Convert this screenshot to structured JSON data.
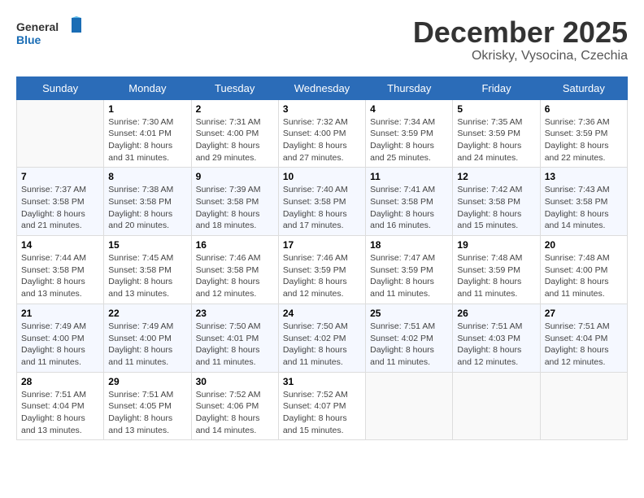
{
  "header": {
    "logo_general": "General",
    "logo_blue": "Blue",
    "month_title": "December 2025",
    "subtitle": "Okrisky, Vysocina, Czechia"
  },
  "days_of_week": [
    "Sunday",
    "Monday",
    "Tuesday",
    "Wednesday",
    "Thursday",
    "Friday",
    "Saturday"
  ],
  "weeks": [
    [
      {
        "day": "",
        "info": ""
      },
      {
        "day": "1",
        "info": "Sunrise: 7:30 AM\nSunset: 4:01 PM\nDaylight: 8 hours\nand 31 minutes."
      },
      {
        "day": "2",
        "info": "Sunrise: 7:31 AM\nSunset: 4:00 PM\nDaylight: 8 hours\nand 29 minutes."
      },
      {
        "day": "3",
        "info": "Sunrise: 7:32 AM\nSunset: 4:00 PM\nDaylight: 8 hours\nand 27 minutes."
      },
      {
        "day": "4",
        "info": "Sunrise: 7:34 AM\nSunset: 3:59 PM\nDaylight: 8 hours\nand 25 minutes."
      },
      {
        "day": "5",
        "info": "Sunrise: 7:35 AM\nSunset: 3:59 PM\nDaylight: 8 hours\nand 24 minutes."
      },
      {
        "day": "6",
        "info": "Sunrise: 7:36 AM\nSunset: 3:59 PM\nDaylight: 8 hours\nand 22 minutes."
      }
    ],
    [
      {
        "day": "7",
        "info": "Sunrise: 7:37 AM\nSunset: 3:58 PM\nDaylight: 8 hours\nand 21 minutes."
      },
      {
        "day": "8",
        "info": "Sunrise: 7:38 AM\nSunset: 3:58 PM\nDaylight: 8 hours\nand 20 minutes."
      },
      {
        "day": "9",
        "info": "Sunrise: 7:39 AM\nSunset: 3:58 PM\nDaylight: 8 hours\nand 18 minutes."
      },
      {
        "day": "10",
        "info": "Sunrise: 7:40 AM\nSunset: 3:58 PM\nDaylight: 8 hours\nand 17 minutes."
      },
      {
        "day": "11",
        "info": "Sunrise: 7:41 AM\nSunset: 3:58 PM\nDaylight: 8 hours\nand 16 minutes."
      },
      {
        "day": "12",
        "info": "Sunrise: 7:42 AM\nSunset: 3:58 PM\nDaylight: 8 hours\nand 15 minutes."
      },
      {
        "day": "13",
        "info": "Sunrise: 7:43 AM\nSunset: 3:58 PM\nDaylight: 8 hours\nand 14 minutes."
      }
    ],
    [
      {
        "day": "14",
        "info": "Sunrise: 7:44 AM\nSunset: 3:58 PM\nDaylight: 8 hours\nand 13 minutes."
      },
      {
        "day": "15",
        "info": "Sunrise: 7:45 AM\nSunset: 3:58 PM\nDaylight: 8 hours\nand 13 minutes."
      },
      {
        "day": "16",
        "info": "Sunrise: 7:46 AM\nSunset: 3:58 PM\nDaylight: 8 hours\nand 12 minutes."
      },
      {
        "day": "17",
        "info": "Sunrise: 7:46 AM\nSunset: 3:59 PM\nDaylight: 8 hours\nand 12 minutes."
      },
      {
        "day": "18",
        "info": "Sunrise: 7:47 AM\nSunset: 3:59 PM\nDaylight: 8 hours\nand 11 minutes."
      },
      {
        "day": "19",
        "info": "Sunrise: 7:48 AM\nSunset: 3:59 PM\nDaylight: 8 hours\nand 11 minutes."
      },
      {
        "day": "20",
        "info": "Sunrise: 7:48 AM\nSunset: 4:00 PM\nDaylight: 8 hours\nand 11 minutes."
      }
    ],
    [
      {
        "day": "21",
        "info": "Sunrise: 7:49 AM\nSunset: 4:00 PM\nDaylight: 8 hours\nand 11 minutes."
      },
      {
        "day": "22",
        "info": "Sunrise: 7:49 AM\nSunset: 4:00 PM\nDaylight: 8 hours\nand 11 minutes."
      },
      {
        "day": "23",
        "info": "Sunrise: 7:50 AM\nSunset: 4:01 PM\nDaylight: 8 hours\nand 11 minutes."
      },
      {
        "day": "24",
        "info": "Sunrise: 7:50 AM\nSunset: 4:02 PM\nDaylight: 8 hours\nand 11 minutes."
      },
      {
        "day": "25",
        "info": "Sunrise: 7:51 AM\nSunset: 4:02 PM\nDaylight: 8 hours\nand 11 minutes."
      },
      {
        "day": "26",
        "info": "Sunrise: 7:51 AM\nSunset: 4:03 PM\nDaylight: 8 hours\nand 12 minutes."
      },
      {
        "day": "27",
        "info": "Sunrise: 7:51 AM\nSunset: 4:04 PM\nDaylight: 8 hours\nand 12 minutes."
      }
    ],
    [
      {
        "day": "28",
        "info": "Sunrise: 7:51 AM\nSunset: 4:04 PM\nDaylight: 8 hours\nand 13 minutes."
      },
      {
        "day": "29",
        "info": "Sunrise: 7:51 AM\nSunset: 4:05 PM\nDaylight: 8 hours\nand 13 minutes."
      },
      {
        "day": "30",
        "info": "Sunrise: 7:52 AM\nSunset: 4:06 PM\nDaylight: 8 hours\nand 14 minutes."
      },
      {
        "day": "31",
        "info": "Sunrise: 7:52 AM\nSunset: 4:07 PM\nDaylight: 8 hours\nand 15 minutes."
      },
      {
        "day": "",
        "info": ""
      },
      {
        "day": "",
        "info": ""
      },
      {
        "day": "",
        "info": ""
      }
    ]
  ]
}
